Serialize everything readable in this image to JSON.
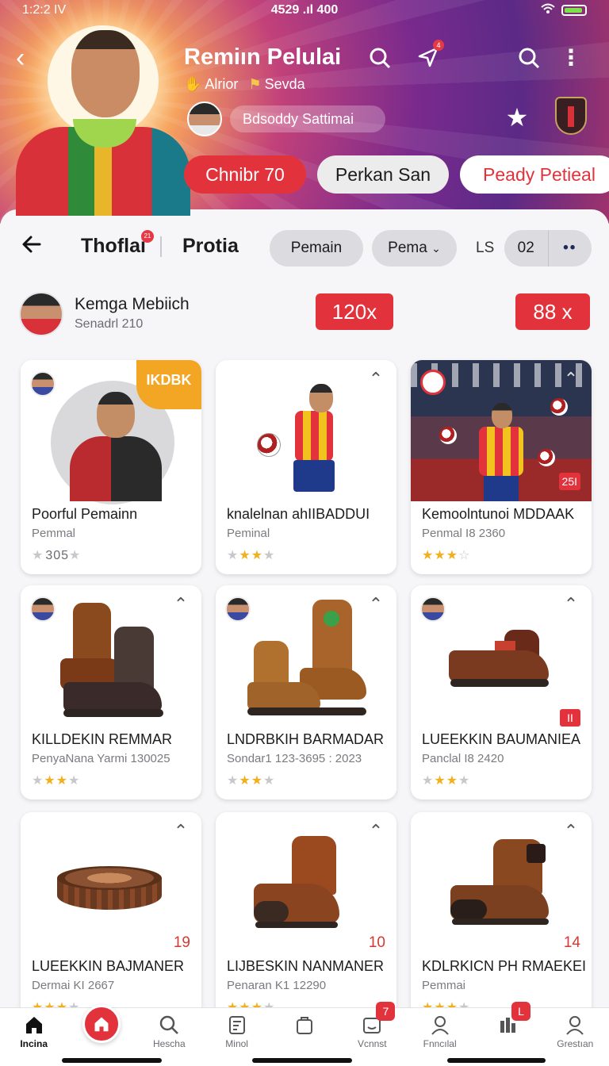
{
  "status_bar": {
    "time": "1:2:2 IV",
    "center": "4529 .ıl 400"
  },
  "header": {
    "title": "Remiın Pelulai",
    "subtitle": "Alrior",
    "subtitle2": "Sevda",
    "user_pill": "Bdsoddy Sattimai",
    "send_badge": "4",
    "chips": [
      "Chnibr 70",
      "Perkan San",
      "Peady Petieal"
    ]
  },
  "toolbar": {
    "title": "Thoflai",
    "title_badge": "21",
    "subtitle": "Protia",
    "filter1": "Pemain",
    "filter2": "Pema",
    "ls_label": "LS",
    "seg_value": "02",
    "seg_more": "••"
  },
  "seller": {
    "name": "Kemga Mebiich",
    "sub": "Senadrl 210",
    "tag1": "120x",
    "tag2": "88 x"
  },
  "cards": [
    {
      "title": "Poorful Pemainn",
      "meta": "Pemmal",
      "rating": "305",
      "corner": "IKDBK"
    },
    {
      "title": "knalelnan ahIIBADDUI",
      "meta": "Peminal"
    },
    {
      "title": "Kemoolntunoi MDDAAK",
      "meta": "Penmal I8 2360",
      "tag": "25I"
    },
    {
      "title": "KILLDEKIN REMMAR",
      "meta": "PenyaNana Yarmi 130025"
    },
    {
      "title": "LNDRBKIH BARMADAR",
      "meta": "Sondar1 123-3695 : 2023"
    },
    {
      "title": "LUEEKKIN BAUMANIEA",
      "meta": "Panclal I8 2420",
      "tag": "II"
    },
    {
      "title": "LUEEKKIN BAJMANER",
      "meta": "Dermai KI 2667",
      "num": "19"
    },
    {
      "title": "LIJBESKIN NANMANER",
      "meta": "Penaran K1 12290",
      "num": "10"
    },
    {
      "title": "KDLRKICN PH RMAEKEI",
      "meta": "Pemmai",
      "num": "14"
    }
  ],
  "bottom_nav": [
    {
      "label": "Incina",
      "icon": "home-icon"
    },
    {
      "label": "",
      "icon": "home-fab-icon"
    },
    {
      "label": "Hescha",
      "icon": "search-icon"
    },
    {
      "label": "Minol",
      "icon": "note-icon"
    },
    {
      "label": "",
      "icon": "bag-icon"
    },
    {
      "label": "Vcnnst",
      "icon": "inbox-icon",
      "badge": "7"
    },
    {
      "label": "Fnncılal",
      "icon": "profile-icon"
    },
    {
      "label": "",
      "icon": "stats-icon",
      "badge": "L"
    },
    {
      "label": "Grestıan",
      "icon": "user-icon"
    }
  ],
  "colors": {
    "accent": "#e2333d",
    "orange": "#f2a623",
    "hero_purple": "#7a2a8d"
  }
}
